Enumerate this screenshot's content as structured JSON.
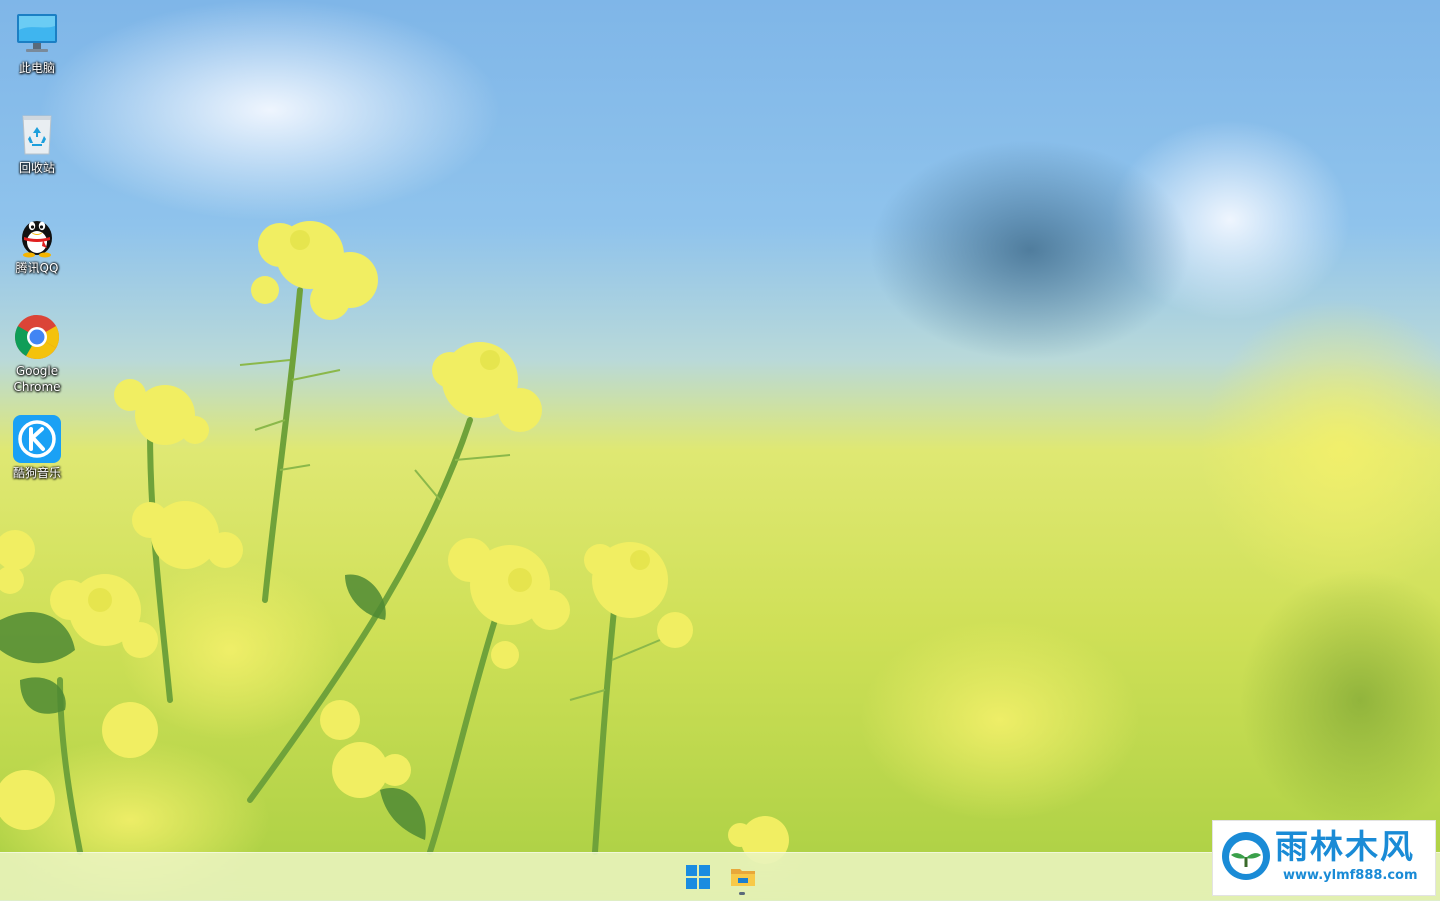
{
  "desktop": {
    "icons": [
      {
        "label": "此电脑",
        "icon": "computer-icon"
      },
      {
        "label": "回收站",
        "icon": "recycle-bin-icon"
      },
      {
        "label": "腾讯QQ",
        "icon": "qq-icon"
      },
      {
        "label": "Google\nChrome",
        "icon": "chrome-icon"
      },
      {
        "label": "酷狗音乐",
        "icon": "kugou-icon"
      }
    ]
  },
  "taskbar": {
    "items": [
      {
        "name": "start",
        "icon": "windows-start-icon"
      },
      {
        "name": "file-explorer",
        "icon": "folder-icon",
        "active": true
      }
    ]
  },
  "watermark": {
    "title": "雨林木风",
    "url": "www.ylmf888.com",
    "icon": "ylmf-logo-icon"
  },
  "colors": {
    "sky": "#8fc2ea",
    "field": "#d4e36a",
    "flower": "#f2f06a",
    "stem": "#6fa23a",
    "watermark_blue": "#1a8bd6"
  }
}
